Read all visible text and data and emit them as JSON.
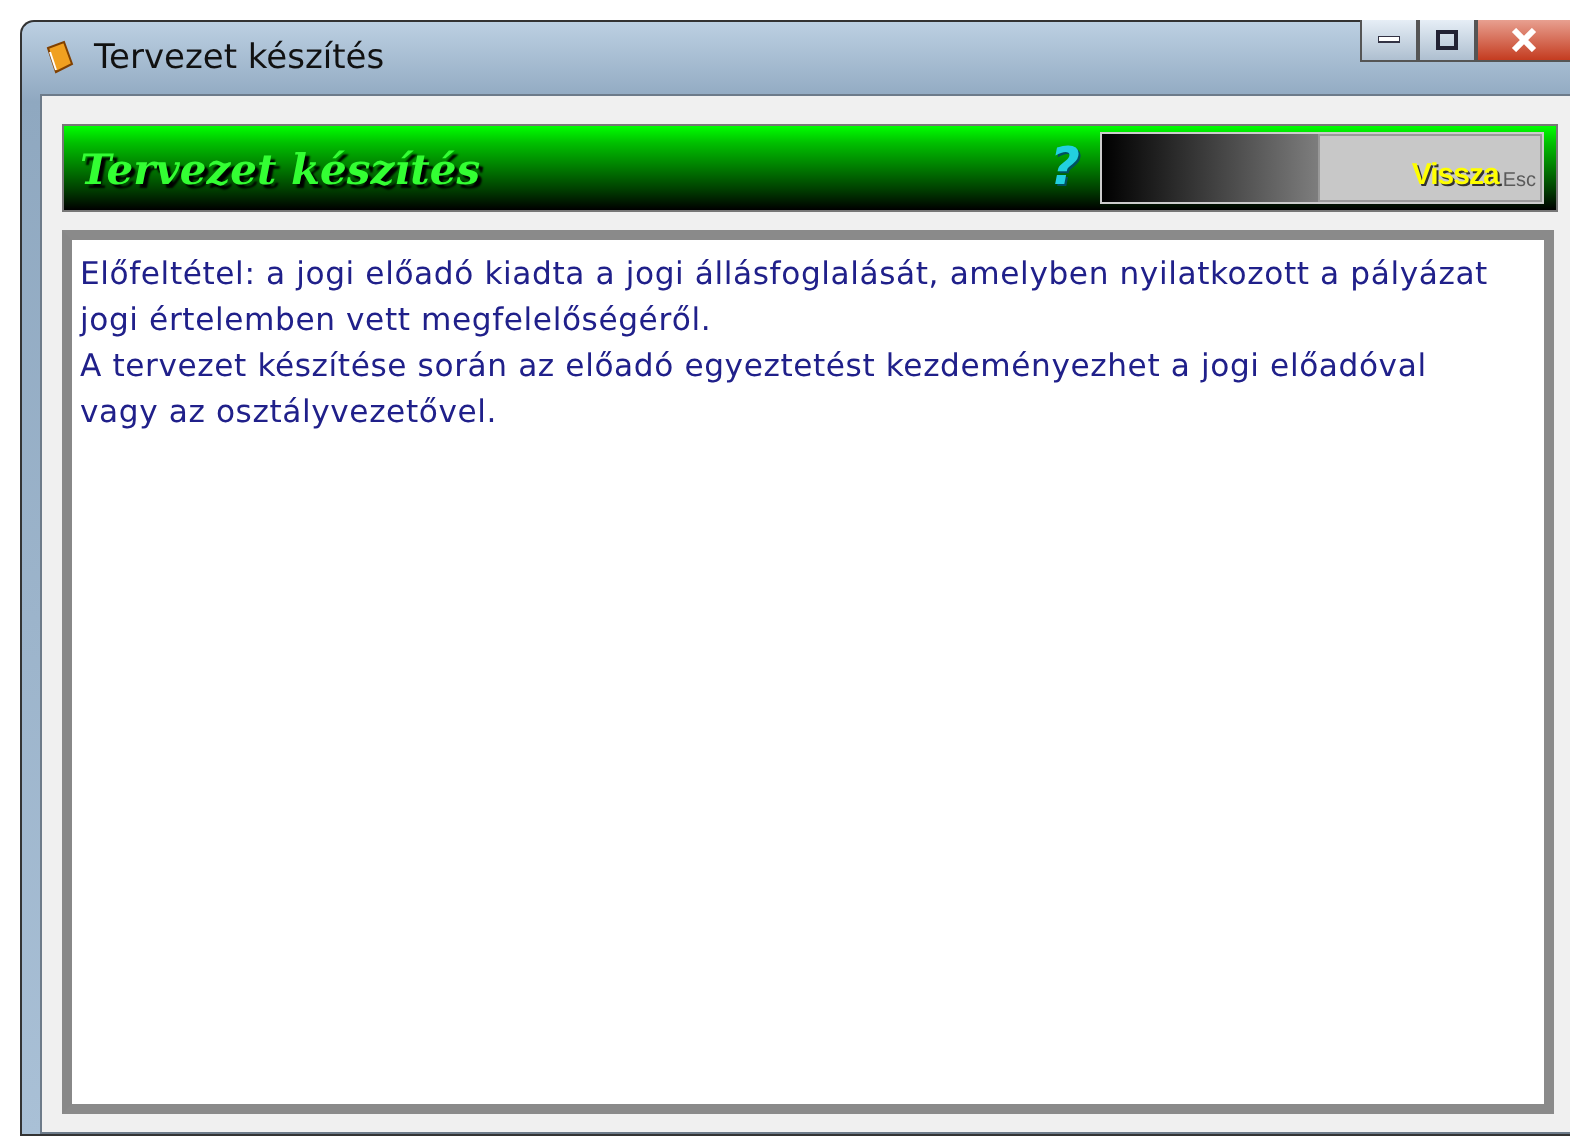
{
  "window": {
    "title": "Tervezet készítés"
  },
  "header": {
    "title": "Tervezet készítés",
    "help": "?",
    "back_button": {
      "label": "Vissza",
      "shortcut": "Esc"
    }
  },
  "content": {
    "lines": [
      "Előfeltétel:  a jogi előadó kiadta a jogi állásfoglalását, amelyben nyilatkozott a pályázat",
      "jogi értelemben vett megfelelőségéről.",
      "A tervezet készítése során az előadó egyeztetést kezdeményezhet a jogi előadóval",
      "vagy az osztályvezetővel."
    ]
  }
}
